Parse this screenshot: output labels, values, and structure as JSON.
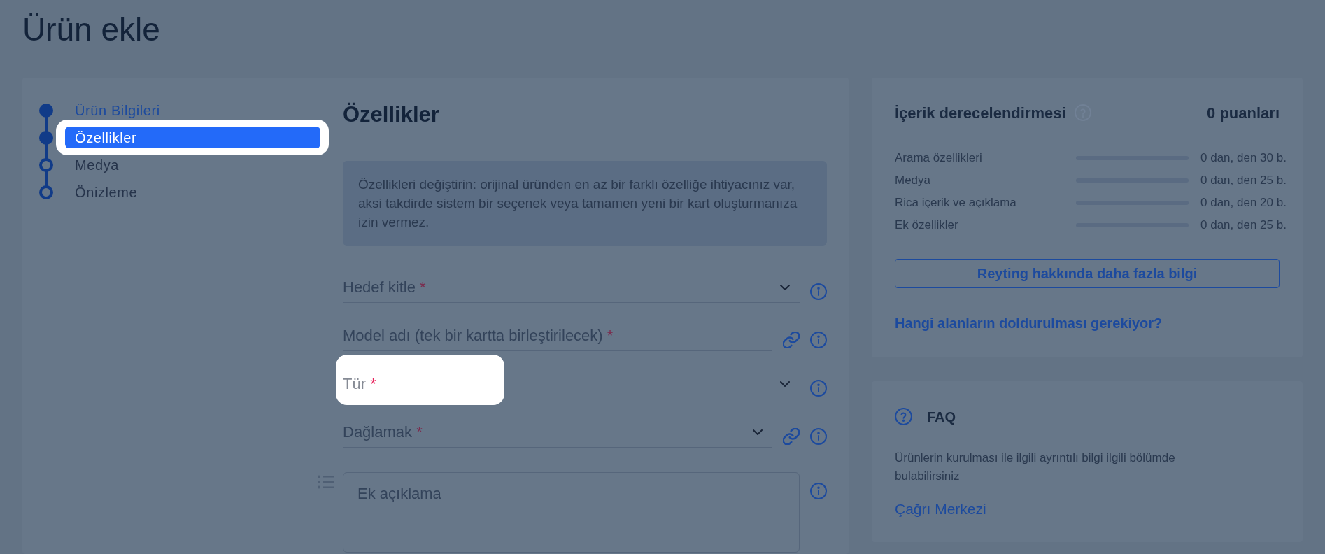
{
  "page": {
    "title": "Ürün ekle"
  },
  "steps": [
    {
      "label": "Ürün Bilgileri",
      "completed": true,
      "selected": false,
      "spotlight": false
    },
    {
      "label": "Özellikler",
      "completed": false,
      "selected": true,
      "spotlight": true
    },
    {
      "label": "Medya",
      "completed": false,
      "selected": false,
      "spotlight": false
    },
    {
      "label": "Önizleme",
      "completed": false,
      "selected": false,
      "spotlight": false
    }
  ],
  "section": {
    "title": "Özellikler",
    "notice": "Özellikleri değiştirin: orijinal üründen en az bir farklı özelliğe ihtiyacınız var, aksi takdirde sistem bir seçenek veya tamamen yeni bir kart oluşturmanıza izin vermez.",
    "fields": [
      {
        "kind": "select",
        "label": "Hedef kitle",
        "required_mark": "*",
        "link": false,
        "spotlight": false
      },
      {
        "kind": "text",
        "label": "Model adı (tek bir kartta birleştirilecek)",
        "required_mark": "*",
        "link": true,
        "spotlight": false
      },
      {
        "kind": "select",
        "label": "Tür",
        "required_mark": "*",
        "link": false,
        "spotlight": true
      },
      {
        "kind": "select",
        "label": "Dağlamak",
        "required_mark": "*",
        "link": true,
        "spotlight": false
      },
      {
        "kind": "textarea",
        "placeholder": "Ek açıklama",
        "link": false,
        "spotlight": false
      }
    ]
  },
  "rating": {
    "title": "İçerik derecelendirmesi",
    "score": "0 puanları",
    "rows": [
      {
        "label": "Arama özellikleri",
        "level": 0,
        "value": "0 dan, den 30 b."
      },
      {
        "label": "Medya",
        "level": 0,
        "value": "0 dan, den 25 b."
      },
      {
        "label": "Rica içerik ve açıklama",
        "level": 0,
        "value": "0 dan, den 20 b."
      },
      {
        "label": "Ek özellikler",
        "level": 0,
        "value": "0 dan, den 25 b."
      }
    ],
    "button": "Reyting hakkında daha fazla bilgi",
    "link": "Hangi alanların doldurulması gerekiyor?"
  },
  "faq": {
    "title": "FAQ",
    "text": "Ürünlerin kurulması ile ilgili ayrıntılı bilgi ilgili bölümde bulabilirsiniz",
    "link": "Çağrı Merkezi"
  }
}
